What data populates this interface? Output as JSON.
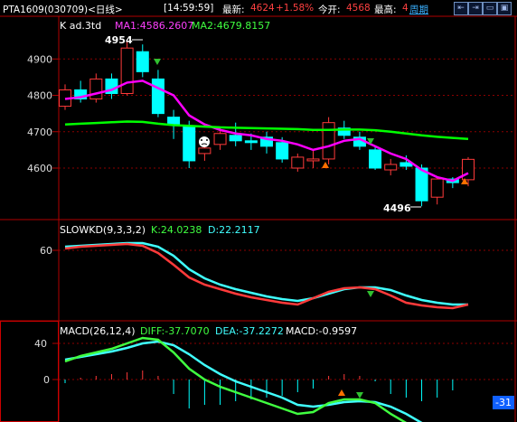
{
  "header": {
    "symbol": "PTA1609(030709)<日线>",
    "time": "[14:59:59]",
    "last_label": "最新:",
    "last_value": "4624",
    "change": "+1.58%",
    "open_label": "今开:",
    "open_value": "4568",
    "high_label": "最高:",
    "high_value": "4",
    "period": "周期"
  },
  "buttons": [
    "⇤",
    "⇥",
    "▭",
    "▣"
  ],
  "main_panel": {
    "title": "K  ad.3td",
    "ma1": "MA1:4586.2607",
    "ma2": "MA2:4679.8157",
    "high_marker": "4954",
    "low_marker": "4496",
    "y_ticks": [
      "4900",
      "4800",
      "4700",
      "4600"
    ]
  },
  "kd_panel": {
    "title": "SLOWKD(9,3,3,2)",
    "k": "K:24.0238",
    "d": "D:22.2117",
    "y_ticks": [
      "60"
    ]
  },
  "macd_panel": {
    "title": "MACD(26,12,4)",
    "diff": "DIFF:-37.7070",
    "dea": "DEA:-37.2272",
    "macd": "MACD:-0.9597",
    "y_ticks": [
      "40",
      "0"
    ],
    "right_badge": "-31"
  },
  "colors": {
    "up": "#ff3a3a",
    "down": "#00ffff",
    "ma1": "#ff00ff",
    "ma2": "#00ff00",
    "grid": "#8b0000"
  },
  "chart_data": {
    "type": "candlestick",
    "price_axis": [
      4600,
      4700,
      4800,
      4900
    ],
    "candles": [
      {
        "o": 4770,
        "h": 4830,
        "l": 4760,
        "c": 4815
      },
      {
        "o": 4815,
        "h": 4840,
        "l": 4780,
        "c": 4790
      },
      {
        "o": 4790,
        "h": 4860,
        "l": 4780,
        "c": 4845
      },
      {
        "o": 4845,
        "h": 4860,
        "l": 4790,
        "c": 4805
      },
      {
        "o": 4805,
        "h": 4950,
        "l": 4800,
        "c": 4930
      },
      {
        "o": 4920,
        "h": 4940,
        "l": 4850,
        "c": 4865
      },
      {
        "o": 4845,
        "h": 4870,
        "l": 4740,
        "c": 4750
      },
      {
        "o": 4740,
        "h": 4760,
        "l": 4680,
        "c": 4720
      },
      {
        "o": 4715,
        "h": 4730,
        "l": 4600,
        "c": 4620
      },
      {
        "o": 4640,
        "h": 4670,
        "l": 4620,
        "c": 4655
      },
      {
        "o": 4665,
        "h": 4710,
        "l": 4650,
        "c": 4695
      },
      {
        "o": 4690,
        "h": 4725,
        "l": 4660,
        "c": 4675
      },
      {
        "o": 4675,
        "h": 4695,
        "l": 4650,
        "c": 4670
      },
      {
        "o": 4685,
        "h": 4700,
        "l": 4640,
        "c": 4660
      },
      {
        "o": 4670,
        "h": 4685,
        "l": 4615,
        "c": 4625
      },
      {
        "o": 4600,
        "h": 4640,
        "l": 4590,
        "c": 4630
      },
      {
        "o": 4620,
        "h": 4650,
        "l": 4600,
        "c": 4625
      },
      {
        "o": 4625,
        "h": 4740,
        "l": 4610,
        "c": 4725
      },
      {
        "o": 4710,
        "h": 4730,
        "l": 4680,
        "c": 4690
      },
      {
        "o": 4685,
        "h": 4700,
        "l": 4650,
        "c": 4660
      },
      {
        "o": 4650,
        "h": 4660,
        "l": 4595,
        "c": 4600
      },
      {
        "o": 4595,
        "h": 4625,
        "l": 4580,
        "c": 4610
      },
      {
        "o": 4615,
        "h": 4635,
        "l": 4595,
        "c": 4605
      },
      {
        "o": 4600,
        "h": 4610,
        "l": 4495,
        "c": 4510
      },
      {
        "o": 4520,
        "h": 4575,
        "l": 4500,
        "c": 4570
      },
      {
        "o": 4570,
        "h": 4575,
        "l": 4545,
        "c": 4560
      },
      {
        "o": 4568,
        "h": 4630,
        "l": 4550,
        "c": 4624
      }
    ],
    "ma1": [
      4790,
      4795,
      4805,
      4815,
      4835,
      4840,
      4820,
      4800,
      4745,
      4720,
      4705,
      4695,
      4690,
      4680,
      4675,
      4665,
      4650,
      4660,
      4675,
      4680,
      4660,
      4640,
      4625,
      4595,
      4575,
      4565,
      4586
    ],
    "ma2": [
      4720,
      4722,
      4724,
      4726,
      4728,
      4727,
      4722,
      4718,
      4716,
      4714,
      4712,
      4711,
      4710,
      4709,
      4708,
      4707,
      4705,
      4705,
      4706,
      4706,
      4704,
      4700,
      4695,
      4690,
      4686,
      4683,
      4680
    ],
    "kd_k": [
      70,
      72,
      73,
      74,
      75,
      73,
      65,
      52,
      38,
      30,
      25,
      20,
      16,
      13,
      10,
      8,
      15,
      22,
      26,
      27,
      25,
      18,
      10,
      7,
      5,
      4,
      8
    ],
    "kd_d": [
      70,
      71,
      72,
      73,
      74,
      74,
      70,
      60,
      45,
      35,
      28,
      23,
      19,
      15,
      12,
      10,
      13,
      18,
      23,
      25,
      25,
      22,
      16,
      11,
      8,
      6,
      6
    ],
    "macd_diff": [
      20,
      26,
      30,
      34,
      40,
      46,
      44,
      30,
      12,
      0,
      -8,
      -14,
      -20,
      -26,
      -32,
      -38,
      -36,
      -26,
      -22,
      -22,
      -26,
      -38,
      -48,
      -60,
      -68,
      -70,
      -64
    ],
    "macd_dea": [
      22,
      25,
      28,
      31,
      35,
      40,
      42,
      38,
      28,
      16,
      6,
      -2,
      -8,
      -14,
      -20,
      -28,
      -30,
      -28,
      -25,
      -24,
      -25,
      -30,
      -38,
      -48,
      -58,
      -64,
      -64
    ],
    "macd_bar": [
      -4,
      2,
      4,
      6,
      8,
      10,
      4,
      -16,
      -32,
      -28,
      -28,
      -24,
      -22,
      -20,
      -18,
      -14,
      -10,
      4,
      6,
      4,
      -2,
      -16,
      -20,
      -24,
      -20,
      -12,
      0
    ]
  }
}
